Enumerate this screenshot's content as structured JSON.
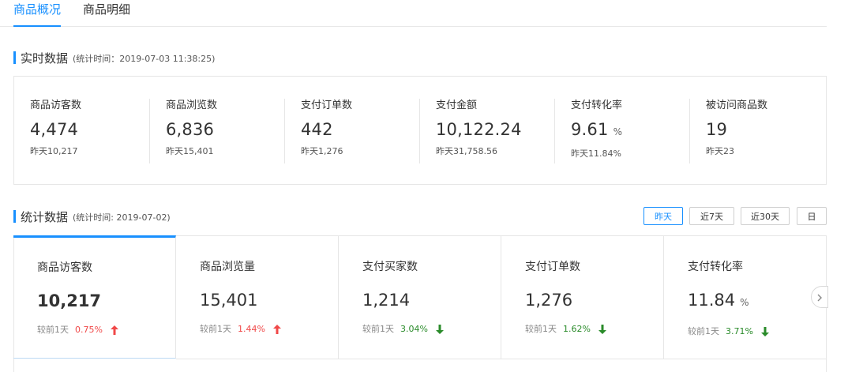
{
  "tabs": [
    {
      "label": "商品概况",
      "active": true
    },
    {
      "label": "商品明细",
      "active": false
    }
  ],
  "realtime": {
    "title": "实时数据",
    "time": "(统计时间：2019-07-03 11:38:25)",
    "items": [
      {
        "label": "商品访客数",
        "value": "4,474",
        "unit": "",
        "prev": "昨天10,217"
      },
      {
        "label": "商品浏览数",
        "value": "6,836",
        "unit": "",
        "prev": "昨天15,401"
      },
      {
        "label": "支付订单数",
        "value": "442",
        "unit": "",
        "prev": "昨天1,276"
      },
      {
        "label": "支付金额",
        "value": "10,122.24",
        "unit": "",
        "prev": "昨天31,758.56"
      },
      {
        "label": "支付转化率",
        "value": "9.61",
        "unit": "%",
        "prev": "昨天11.84%"
      },
      {
        "label": "被访问商品数",
        "value": "19",
        "unit": "",
        "prev": "昨天23"
      }
    ]
  },
  "stats": {
    "title": "统计数据",
    "time": "(统计时间: 2019-07-02)",
    "date_buttons": [
      {
        "label": "昨天",
        "active": true
      },
      {
        "label": "近7天",
        "active": false
      },
      {
        "label": "近30天",
        "active": false
      },
      {
        "label": "日",
        "active": false
      }
    ],
    "cards": [
      {
        "label": "商品访客数",
        "value": "10,217",
        "unit": "",
        "cmp_label": "较前1天",
        "cmp_pct": "0.75%",
        "trend": "up",
        "active": true
      },
      {
        "label": "商品浏览量",
        "value": "15,401",
        "unit": "",
        "cmp_label": "较前1天",
        "cmp_pct": "1.44%",
        "trend": "up",
        "active": false
      },
      {
        "label": "支付买家数",
        "value": "1,214",
        "unit": "",
        "cmp_label": "较前1天",
        "cmp_pct": "3.04%",
        "trend": "down",
        "active": false
      },
      {
        "label": "支付订单数",
        "value": "1,276",
        "unit": "",
        "cmp_label": "较前1天",
        "cmp_pct": "1.62%",
        "trend": "down",
        "active": false
      },
      {
        "label": "支付转化率",
        "value": "11.84",
        "unit": "%",
        "cmp_label": "较前1天",
        "cmp_pct": "3.71%",
        "trend": "down",
        "active": false
      }
    ]
  },
  "colors": {
    "accent": "#1890ff",
    "up": "#f04848",
    "down": "#2a8b2a"
  },
  "icons": {
    "up": "arrow-up-icon",
    "down": "arrow-down-icon",
    "next": "chevron-right-icon"
  }
}
